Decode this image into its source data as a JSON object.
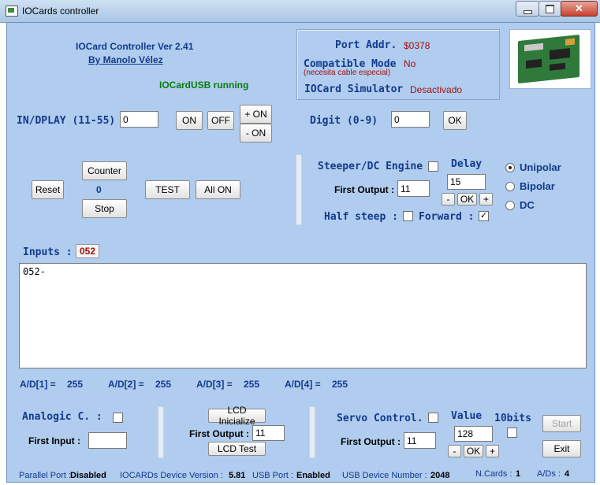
{
  "window": {
    "title": "IOCards controller"
  },
  "header": {
    "app_name": "IOCard Controller  Ver 2.41",
    "author": "By Manolo Vélez",
    "status": "IOCardUSB running"
  },
  "port_panel": {
    "port_label": "Port Addr.",
    "port_value": "$0378",
    "compat_label": "Compatible Mode",
    "compat_value": "No",
    "compat_note": "(necesita cable especial)",
    "sim_label": "IOCard Simulator",
    "sim_value": "Desactivado"
  },
  "display": {
    "label": "IN/DPLAY (11-55)",
    "value": "0",
    "on": "ON",
    "off": "OFF",
    "plus_on": "+ ON",
    "minus_on": "- ON"
  },
  "digit": {
    "label": "Digit  (0-9)",
    "value": "0",
    "ok": "OK"
  },
  "counter": {
    "counter": "Counter",
    "value": "0",
    "stop": "Stop",
    "reset": "Reset",
    "test": "TEST",
    "all_on": "All ON"
  },
  "stepper": {
    "label": "Steeper/DC Engine",
    "delay_label": "Delay",
    "delay_value": "15",
    "first_output_label": "First Output :",
    "first_output_value": "11",
    "minus": "-",
    "ok": "OK",
    "plus": "+",
    "half_steep": "Half steep :",
    "forward": "Forward :",
    "forward_checked": true,
    "modes": [
      {
        "label": "Unipolar",
        "selected": true
      },
      {
        "label": "Bipolar",
        "selected": false
      },
      {
        "label": "DC",
        "selected": false
      }
    ]
  },
  "inputs": {
    "label": "Inputs :",
    "value": "052",
    "log": "052-"
  },
  "ad": [
    {
      "label": "A/D[1] =",
      "value": "255"
    },
    {
      "label": "A/D[2] =",
      "value": "255"
    },
    {
      "label": "A/D[3] =",
      "value": "255"
    },
    {
      "label": "A/D[4] =",
      "value": "255"
    }
  ],
  "analogic": {
    "label": "Analogic C. :",
    "first_input_label": "First Input  :",
    "first_input_value": ""
  },
  "lcd": {
    "init": "LCD Inicialize",
    "first_output_label": "First Output :",
    "first_output_value": "11",
    "test": "LCD Test"
  },
  "servo": {
    "label": "Servo Control.",
    "value_label": "Value",
    "value": "128",
    "bits_label": "10bits",
    "first_output_label": "First Output :",
    "first_output_value": "11",
    "minus": "-",
    "ok": "OK",
    "plus": "+",
    "start": "Start",
    "exit": "Exit"
  },
  "status_bar": {
    "parallel_label": "Parallel Port :",
    "parallel_value": "Disabled",
    "version_label": "IOCARDs Device  Version :",
    "version_value": "5.81",
    "usb_label": "USB Port :",
    "usb_value": "Enabled",
    "usbnum_label": "USB Device Number :",
    "usbnum_value": "2048",
    "ncards_label": "N.Cards :",
    "ncards_value": "1",
    "ads_label": "A/Ds :",
    "ads_value": "4"
  },
  "colors": {
    "client_bg": "#b0ccee",
    "label_blue": "#123a8c",
    "value_red": "#a01010",
    "running_green": "#0a7a0a",
    "close_red": "#c8402f"
  }
}
